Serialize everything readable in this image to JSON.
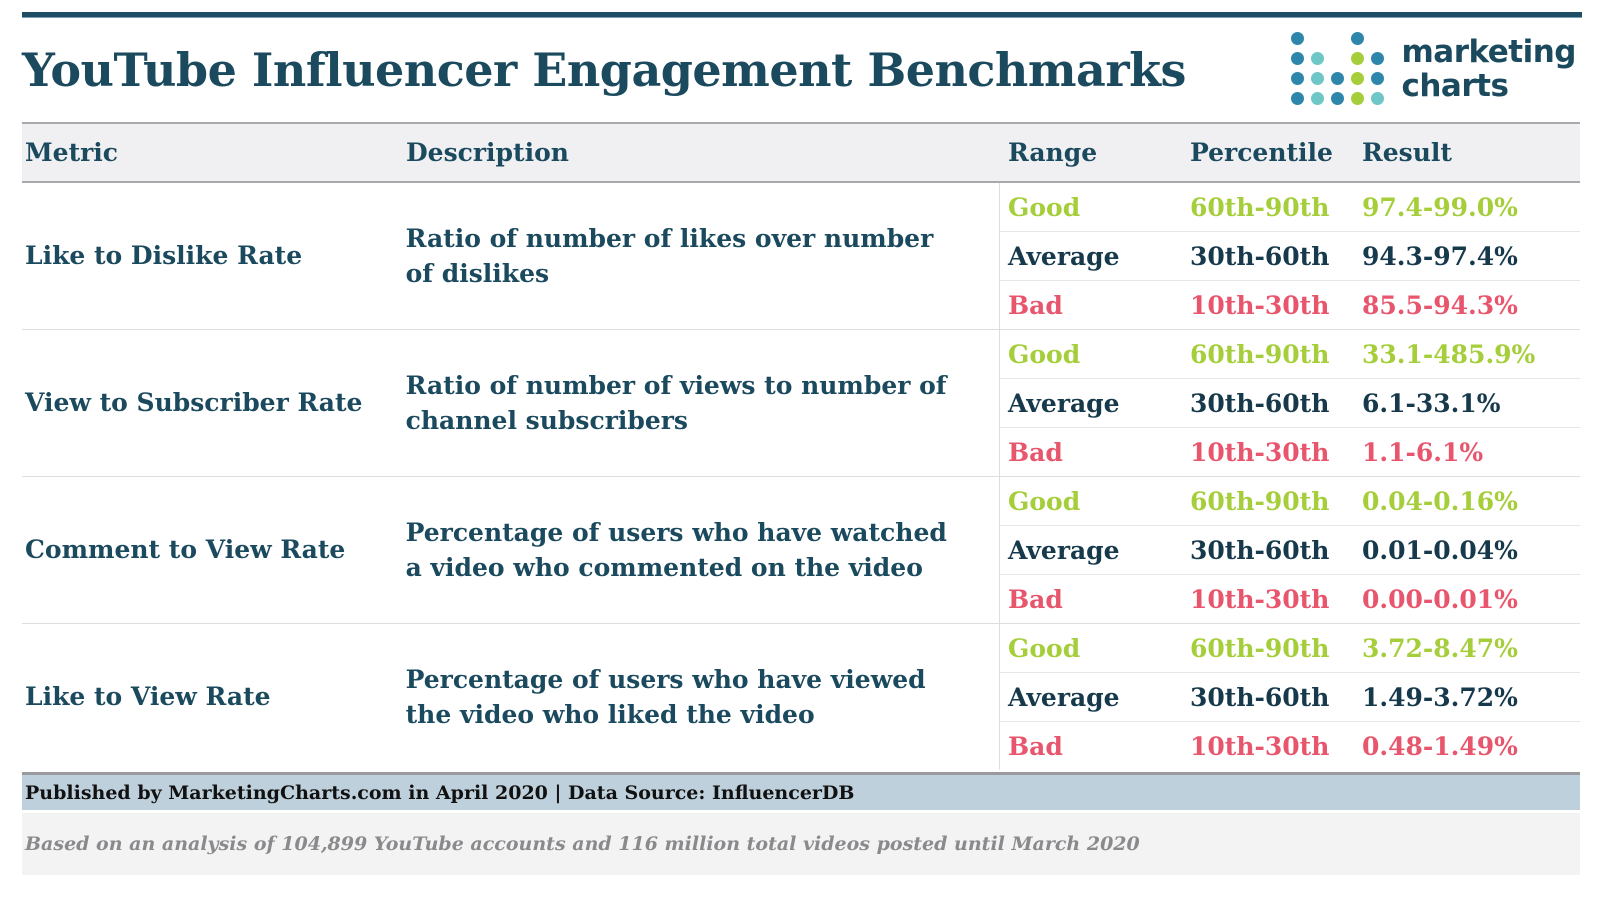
{
  "header": {
    "title": "YouTube Influencer Engagement Benchmarks",
    "logo": {
      "line1": "marketing",
      "line2": "charts"
    }
  },
  "colors": {
    "brand_navy": "#1b4a5e",
    "good_green": "#a5ce3a",
    "average_navy": "#16394b",
    "bad_pink": "#e8566d",
    "publisher_bar": "#bed0dc",
    "header_band": "#f0f0f2"
  },
  "table": {
    "columns": [
      "Metric",
      "Description",
      "Range",
      "Percentile",
      "Result"
    ],
    "groups": [
      {
        "metric": "Like to Dislike Rate",
        "description": "Ratio of number of likes over number of dislikes",
        "rows": [
          {
            "range": "Good",
            "percentile": "60th-90th",
            "result": "97.4-99.0%"
          },
          {
            "range": "Average",
            "percentile": "30th-60th",
            "result": "94.3-97.4%"
          },
          {
            "range": "Bad",
            "percentile": "10th-30th",
            "result": "85.5-94.3%"
          }
        ]
      },
      {
        "metric": "View to Subscriber Rate",
        "description": "Ratio of number of views to number of channel subscribers",
        "rows": [
          {
            "range": "Good",
            "percentile": "60th-90th",
            "result": "33.1-485.9%"
          },
          {
            "range": "Average",
            "percentile": "30th-60th",
            "result": "6.1-33.1%"
          },
          {
            "range": "Bad",
            "percentile": "10th-30th",
            "result": "1.1-6.1%"
          }
        ]
      },
      {
        "metric": "Comment to View Rate",
        "description": "Percentage of users who have watched a video who commented on the video",
        "rows": [
          {
            "range": "Good",
            "percentile": "60th-90th",
            "result": "0.04-0.16%"
          },
          {
            "range": "Average",
            "percentile": "30th-60th",
            "result": "0.01-0.04%"
          },
          {
            "range": "Bad",
            "percentile": "10th-30th",
            "result": "0.00-0.01%"
          }
        ]
      },
      {
        "metric": "Like to View Rate",
        "description": "Percentage of users who have viewed the video who liked the video",
        "rows": [
          {
            "range": "Good",
            "percentile": "60th-90th",
            "result": "3.72-8.47%"
          },
          {
            "range": "Average",
            "percentile": "30th-60th",
            "result": "1.49-3.72%"
          },
          {
            "range": "Bad",
            "percentile": "10th-30th",
            "result": "0.48-1.49%"
          }
        ]
      }
    ]
  },
  "footer": {
    "publisher": "Published by MarketingCharts.com in April 2020 | Data Source: InfluencerDB",
    "note": "Based on an analysis of 104,899 YouTube accounts and 116 million total videos posted until March 2020"
  },
  "logo_dot_grid": [
    [
      "#2e86ab",
      "empty",
      "empty",
      "#2e86ab",
      "empty"
    ],
    [
      "#2e86ab",
      "#6fc6c6",
      "empty",
      "#a5ce3a",
      "#2e86ab"
    ],
    [
      "#2e86ab",
      "#6fc6c6",
      "#2e86ab",
      "#a5ce3a",
      "#2e86ab"
    ],
    [
      "#2e86ab",
      "#6fc6c6",
      "#2e86ab",
      "#a5ce3a",
      "#6fc6c6"
    ]
  ]
}
